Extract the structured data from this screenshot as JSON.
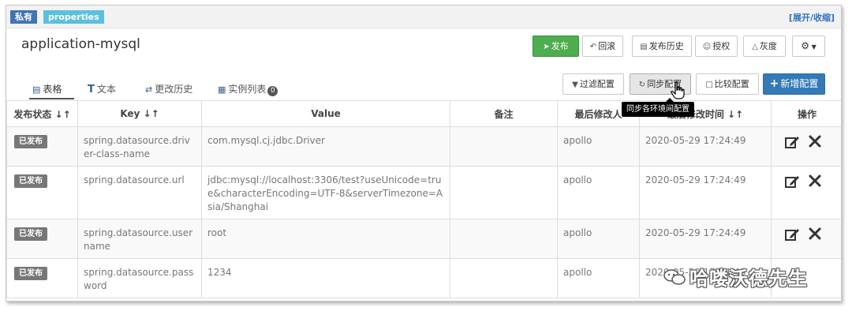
{
  "header": {
    "scope_tag": "私有",
    "format_tag": "properties",
    "expand_collapse": "[展开/收缩]",
    "namespace": "application-mysql"
  },
  "toolbar": {
    "publish": "发布",
    "rollback": "回滚",
    "publish_history": "发布历史",
    "authorize": "授权",
    "gray_release": "灰度"
  },
  "tabs": {
    "table": "表格",
    "text": "文本",
    "change_history": "更改历史",
    "instance_list": "实例列表",
    "instance_count": "0"
  },
  "actions": {
    "filter_config": "过滤配置",
    "sync_config": "同步配置",
    "compare_config": "比较配置",
    "add_config": "新增配置"
  },
  "tooltip": "同步各环境间配置",
  "table": {
    "headers": {
      "status": "发布状态 ↓↑",
      "key": "Key ↓↑",
      "value": "Value",
      "comment": "备注",
      "modifier": "最后修改人",
      "modified_time": "最后修改时间 ↓↑",
      "operations": "操作"
    },
    "rows": [
      {
        "status": "已发布",
        "key": "spring.datasource.driver-class-name",
        "value": "com.mysql.cj.jdbc.Driver",
        "comment": "",
        "modifier": "apollo",
        "time": "2020-05-29 17:24:49"
      },
      {
        "status": "已发布",
        "key": "spring.datasource.url",
        "value": "jdbc:mysql://localhost:3306/test?useUnicode=true&characterEncoding=UTF-8&serverTimezone=Asia/Shanghai",
        "comment": "",
        "modifier": "apollo",
        "time": "2020-05-29 17:24:49"
      },
      {
        "status": "已发布",
        "key": "spring.datasource.username",
        "value": "root",
        "comment": "",
        "modifier": "apollo",
        "time": "2020-05-29 17:24:49"
      },
      {
        "status": "已发布",
        "key": "spring.datasource.password",
        "value": "1234",
        "comment": "",
        "modifier": "apollo",
        "time": "2020-05-29 17:24:49"
      }
    ]
  },
  "watermark": "哈喽沃德先生",
  "colors": {
    "publish_green": "#4cae4c",
    "primary_blue": "#337ab7",
    "tag_blue": "#3f74b5",
    "tag_cyan": "#5bc0de",
    "badge_gray": "#777777"
  }
}
